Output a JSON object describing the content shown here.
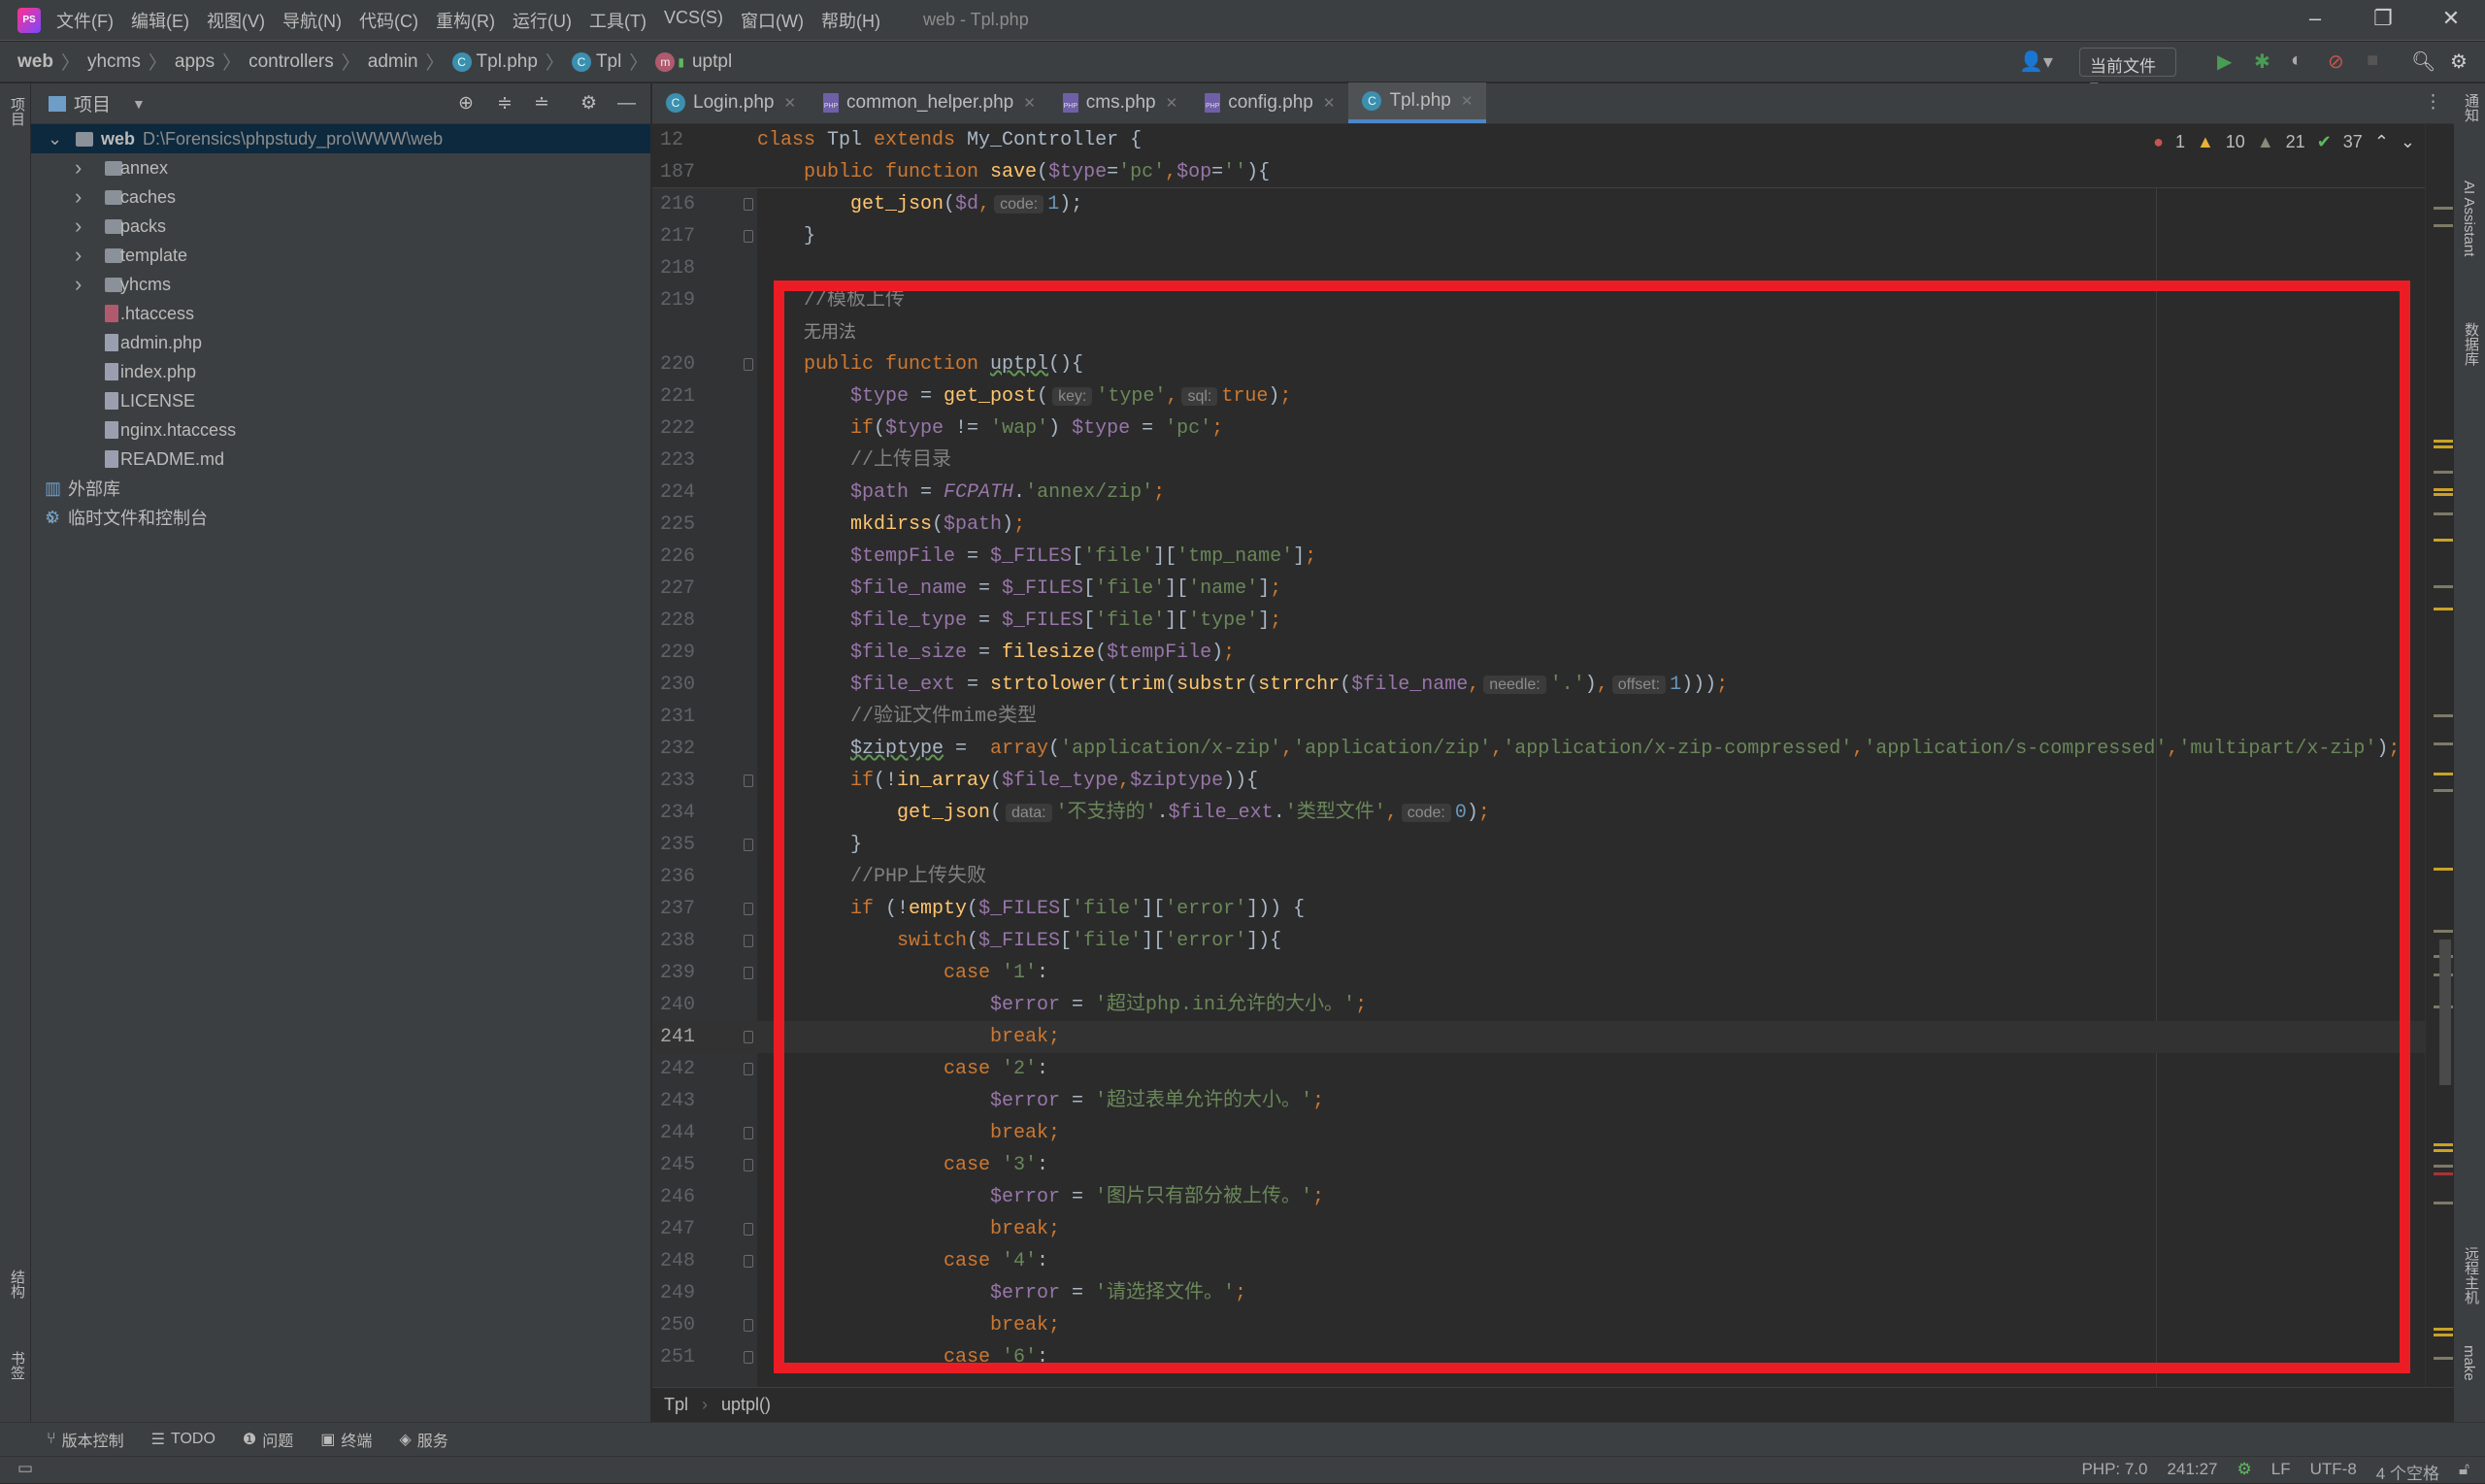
{
  "window": {
    "title": "web - Tpl.php",
    "logo": "PS"
  },
  "menu": [
    "文件(F)",
    "编辑(E)",
    "视图(V)",
    "导航(N)",
    "代码(C)",
    "重构(R)",
    "运行(U)",
    "工具(T)",
    "VCS(S)",
    "窗口(W)",
    "帮助(H)"
  ],
  "breadcrumb": [
    {
      "label": "web",
      "icon": ""
    },
    {
      "label": "yhcms",
      "icon": ""
    },
    {
      "label": "apps",
      "icon": ""
    },
    {
      "label": "controllers",
      "icon": ""
    },
    {
      "label": "admin",
      "icon": ""
    },
    {
      "label": "Tpl.php",
      "icon": "class-icon"
    },
    {
      "label": "Tpl",
      "icon": "class-icon"
    },
    {
      "label": "uptpl",
      "icon": "method-icon"
    }
  ],
  "toolbar": {
    "run_config": "当前文件"
  },
  "left_strip": {
    "project": "项目",
    "structure": "结构",
    "bookmarks": "书签"
  },
  "right_strip": {
    "notifications": "通知",
    "ai": "AI Assistant",
    "database": "数据库",
    "remote": "远程主机",
    "make": "make"
  },
  "project_panel": {
    "title": "项目",
    "tree": [
      {
        "label": "web",
        "path": "D:\\Forensics\\phpstudy_pro\\WWW\\web",
        "type": "folder",
        "level": 0,
        "expanded": true,
        "selected": true
      },
      {
        "label": "annex",
        "type": "folder",
        "level": 1
      },
      {
        "label": "caches",
        "type": "folder",
        "level": 1
      },
      {
        "label": "packs",
        "type": "folder",
        "level": 1
      },
      {
        "label": "template",
        "type": "folder",
        "level": 1
      },
      {
        "label": "yhcms",
        "type": "folder",
        "level": 1
      },
      {
        "label": ".htaccess",
        "type": "file",
        "level": 1
      },
      {
        "label": "admin.php",
        "type": "php",
        "level": 1
      },
      {
        "label": "index.php",
        "type": "php",
        "level": 1
      },
      {
        "label": "LICENSE",
        "type": "file",
        "level": 1
      },
      {
        "label": "nginx.htaccess",
        "type": "file",
        "level": 1
      },
      {
        "label": "README.md",
        "type": "md",
        "level": 1
      },
      {
        "label": "外部库",
        "type": "library",
        "level": 0
      },
      {
        "label": "临时文件和控制台",
        "type": "scratch",
        "level": 0,
        "collapsed": true
      }
    ]
  },
  "tabs": [
    {
      "label": "Login.php",
      "icon": "class-icon",
      "active": false
    },
    {
      "label": "common_helper.php",
      "icon": "php-icon",
      "active": false
    },
    {
      "label": "cms.php",
      "icon": "php-icon",
      "active": false
    },
    {
      "label": "config.php",
      "icon": "php-icon",
      "active": false
    },
    {
      "label": "Tpl.php",
      "icon": "class-icon",
      "active": true
    }
  ],
  "problems": {
    "errors": "1",
    "warnings": "10",
    "weak_warnings": "21",
    "ok": "37"
  },
  "sticky_lines": [
    {
      "n": "12",
      "indent": 0,
      "tokens": [
        [
          "k",
          "class "
        ],
        [
          "d",
          "Tpl "
        ],
        [
          "k",
          "extends "
        ],
        [
          "d",
          "My_Controller {"
        ]
      ]
    },
    {
      "n": "187",
      "indent": 4,
      "tokens": [
        [
          "k",
          "public function "
        ],
        [
          "f",
          "save"
        ],
        [
          "d",
          "("
        ],
        [
          "v",
          "$type"
        ],
        [
          "d",
          "="
        ],
        [
          "s",
          "'pc'"
        ],
        [
          "k",
          ","
        ],
        [
          "v",
          "$op"
        ],
        [
          "d",
          "="
        ],
        [
          "s",
          "''"
        ],
        [
          "d",
          "){"
        ]
      ]
    }
  ],
  "code_lines": [
    {
      "n": "216",
      "indent": 8,
      "fold": true,
      "tokens": [
        [
          "f",
          "get_json"
        ],
        [
          "d",
          "("
        ],
        [
          "v",
          "$d"
        ],
        [
          "k",
          ","
        ],
        [
          "h",
          "code:"
        ],
        [
          "n",
          "1"
        ],
        [
          "d",
          ");"
        ]
      ]
    },
    {
      "n": "217",
      "indent": 4,
      "fold": true,
      "tokens": [
        [
          "d",
          "}"
        ]
      ]
    },
    {
      "n": "218",
      "indent": 0,
      "tokens": []
    },
    {
      "n": "219",
      "indent": 4,
      "tokens": [
        [
          "c",
          "//模板上传"
        ]
      ]
    },
    {
      "n": "",
      "indent": 4,
      "tokens": [
        [
          "p",
          "无用法"
        ]
      ]
    },
    {
      "n": "220",
      "indent": 4,
      "fold": true,
      "tokens": [
        [
          "k",
          "public function "
        ],
        [
          "u",
          "uptpl"
        ],
        [
          "d",
          "(){"
        ]
      ]
    },
    {
      "n": "221",
      "indent": 8,
      "tokens": [
        [
          "v",
          "$type"
        ],
        [
          "d",
          " = "
        ],
        [
          "f",
          "get_post"
        ],
        [
          "d",
          "("
        ],
        [
          "h",
          "key:"
        ],
        [
          "s",
          "'type'"
        ],
        [
          "k",
          ","
        ],
        [
          "h",
          "sql:"
        ],
        [
          "k",
          "true"
        ],
        [
          "d",
          ")"
        ],
        [
          "k",
          ";"
        ]
      ]
    },
    {
      "n": "222",
      "indent": 8,
      "tokens": [
        [
          "k",
          "if"
        ],
        [
          "d",
          "("
        ],
        [
          "v",
          "$type"
        ],
        [
          "d",
          " != "
        ],
        [
          "s",
          "'wap'"
        ],
        [
          "d",
          ") "
        ],
        [
          "v",
          "$type"
        ],
        [
          "d",
          " = "
        ],
        [
          "s",
          "'pc'"
        ],
        [
          "k",
          ";"
        ]
      ]
    },
    {
      "n": "223",
      "indent": 8,
      "tokens": [
        [
          "c",
          "//上传目录"
        ]
      ]
    },
    {
      "n": "224",
      "indent": 8,
      "tokens": [
        [
          "v",
          "$path"
        ],
        [
          "d",
          " = "
        ],
        [
          "i",
          "FCPATH"
        ],
        [
          "d",
          "."
        ],
        [
          "s",
          "'annex/zip'"
        ],
        [
          "k",
          ";"
        ]
      ]
    },
    {
      "n": "225",
      "indent": 8,
      "tokens": [
        [
          "f",
          "mkdirss"
        ],
        [
          "d",
          "("
        ],
        [
          "v",
          "$path"
        ],
        [
          "d",
          ")"
        ],
        [
          "k",
          ";"
        ]
      ]
    },
    {
      "n": "226",
      "indent": 8,
      "tokens": [
        [
          "v",
          "$tempFile"
        ],
        [
          "d",
          " = "
        ],
        [
          "v",
          "$_FILES"
        ],
        [
          "d",
          "["
        ],
        [
          "s",
          "'file'"
        ],
        [
          "d",
          "]["
        ],
        [
          "s",
          "'tmp_name'"
        ],
        [
          "d",
          "]"
        ],
        [
          "k",
          ";"
        ]
      ]
    },
    {
      "n": "227",
      "indent": 8,
      "tokens": [
        [
          "v",
          "$file_name"
        ],
        [
          "d",
          " = "
        ],
        [
          "v",
          "$_FILES"
        ],
        [
          "d",
          "["
        ],
        [
          "s",
          "'file'"
        ],
        [
          "d",
          "]["
        ],
        [
          "s",
          "'name'"
        ],
        [
          "d",
          "]"
        ],
        [
          "k",
          ";"
        ]
      ]
    },
    {
      "n": "228",
      "indent": 8,
      "tokens": [
        [
          "v",
          "$file_type"
        ],
        [
          "d",
          " = "
        ],
        [
          "v",
          "$_FILES"
        ],
        [
          "d",
          "["
        ],
        [
          "s",
          "'file'"
        ],
        [
          "d",
          "]["
        ],
        [
          "s",
          "'type'"
        ],
        [
          "d",
          "]"
        ],
        [
          "k",
          ";"
        ]
      ]
    },
    {
      "n": "229",
      "indent": 8,
      "tokens": [
        [
          "v",
          "$file_size"
        ],
        [
          "d",
          " = "
        ],
        [
          "f",
          "filesize"
        ],
        [
          "d",
          "("
        ],
        [
          "v",
          "$tempFile"
        ],
        [
          "d",
          ")"
        ],
        [
          "k",
          ";"
        ]
      ]
    },
    {
      "n": "230",
      "indent": 8,
      "tokens": [
        [
          "v",
          "$file_ext"
        ],
        [
          "d",
          " = "
        ],
        [
          "f",
          "strtolower"
        ],
        [
          "d",
          "("
        ],
        [
          "f",
          "trim"
        ],
        [
          "d",
          "("
        ],
        [
          "f",
          "substr"
        ],
        [
          "d",
          "("
        ],
        [
          "f",
          "strrchr"
        ],
        [
          "d",
          "("
        ],
        [
          "v",
          "$file_name"
        ],
        [
          "k",
          ","
        ],
        [
          "h",
          "needle:"
        ],
        [
          "s",
          "'.'"
        ],
        [
          "d",
          ")"
        ],
        [
          "k",
          ","
        ],
        [
          "h",
          "offset:"
        ],
        [
          "n",
          "1"
        ],
        [
          "d",
          ")))"
        ],
        [
          "k",
          ";"
        ]
      ]
    },
    {
      "n": "231",
      "indent": 8,
      "tokens": [
        [
          "c",
          "//验证文件mime类型"
        ]
      ]
    },
    {
      "n": "232",
      "indent": 8,
      "tokens": [
        [
          "u",
          "$ziptype"
        ],
        [
          "d",
          " =  "
        ],
        [
          "k",
          "array"
        ],
        [
          "d",
          "("
        ],
        [
          "s",
          "'application/x-zip'"
        ],
        [
          "k",
          ","
        ],
        [
          "s",
          "'application/zip'"
        ],
        [
          "k",
          ","
        ],
        [
          "s",
          "'application/x-zip-compressed'"
        ],
        [
          "k",
          ","
        ],
        [
          "s",
          "'application/s-compressed'"
        ],
        [
          "k",
          ","
        ],
        [
          "s",
          "'multipart/x-zip'"
        ],
        [
          "d",
          ")"
        ],
        [
          "k",
          ";"
        ]
      ]
    },
    {
      "n": "233",
      "indent": 8,
      "fold": true,
      "tokens": [
        [
          "k",
          "if"
        ],
        [
          "d",
          "(!"
        ],
        [
          "f",
          "in_array"
        ],
        [
          "d",
          "("
        ],
        [
          "v",
          "$file_type"
        ],
        [
          "k",
          ","
        ],
        [
          "v",
          "$ziptype"
        ],
        [
          "d",
          "))"
        ],
        [
          "d",
          "{"
        ]
      ]
    },
    {
      "n": "234",
      "indent": 12,
      "tokens": [
        [
          "f",
          "get_json"
        ],
        [
          "d",
          "("
        ],
        [
          "h",
          "data:"
        ],
        [
          "s",
          "'不支持的'"
        ],
        [
          "d",
          "."
        ],
        [
          "v",
          "$file_ext"
        ],
        [
          "d",
          "."
        ],
        [
          "s",
          "'类型文件'"
        ],
        [
          "k",
          ","
        ],
        [
          "h",
          "code:"
        ],
        [
          "n",
          "0"
        ],
        [
          "d",
          ")"
        ],
        [
          "k",
          ";"
        ]
      ]
    },
    {
      "n": "235",
      "indent": 8,
      "fold": true,
      "tokens": [
        [
          "d",
          "}"
        ]
      ]
    },
    {
      "n": "236",
      "indent": 8,
      "tokens": [
        [
          "c",
          "//PHP上传失败"
        ]
      ]
    },
    {
      "n": "237",
      "indent": 8,
      "fold": true,
      "tokens": [
        [
          "k",
          "if "
        ],
        [
          "d",
          "(!"
        ],
        [
          "f",
          "empty"
        ],
        [
          "d",
          "("
        ],
        [
          "v",
          "$_FILES"
        ],
        [
          "d",
          "["
        ],
        [
          "s",
          "'file'"
        ],
        [
          "d",
          "]["
        ],
        [
          "s",
          "'error'"
        ],
        [
          "d",
          "])) {"
        ]
      ]
    },
    {
      "n": "238",
      "indent": 12,
      "fold": true,
      "tokens": [
        [
          "k",
          "switch"
        ],
        [
          "d",
          "("
        ],
        [
          "v",
          "$_FILES"
        ],
        [
          "d",
          "["
        ],
        [
          "s",
          "'file'"
        ],
        [
          "d",
          "]["
        ],
        [
          "s",
          "'error'"
        ],
        [
          "d",
          "]){"
        ]
      ]
    },
    {
      "n": "239",
      "indent": 16,
      "fold": true,
      "tokens": [
        [
          "k",
          "case "
        ],
        [
          "s",
          "'1'"
        ],
        [
          "d",
          ":"
        ]
      ]
    },
    {
      "n": "240",
      "indent": 20,
      "tokens": [
        [
          "v",
          "$error"
        ],
        [
          "d",
          " = "
        ],
        [
          "s",
          "'超过php.ini允许的大小。'"
        ],
        [
          "k",
          ";"
        ]
      ]
    },
    {
      "n": "241",
      "indent": 20,
      "fold": true,
      "current": true,
      "tokens": [
        [
          "k",
          "break;"
        ]
      ]
    },
    {
      "n": "242",
      "indent": 16,
      "fold": true,
      "tokens": [
        [
          "k",
          "case "
        ],
        [
          "s",
          "'2'"
        ],
        [
          "d",
          ":"
        ]
      ]
    },
    {
      "n": "243",
      "indent": 20,
      "tokens": [
        [
          "v",
          "$error"
        ],
        [
          "d",
          " = "
        ],
        [
          "s",
          "'超过表单允许的大小。'"
        ],
        [
          "k",
          ";"
        ]
      ]
    },
    {
      "n": "244",
      "indent": 20,
      "fold": true,
      "tokens": [
        [
          "k",
          "break;"
        ]
      ]
    },
    {
      "n": "245",
      "indent": 16,
      "fold": true,
      "tokens": [
        [
          "k",
          "case "
        ],
        [
          "s",
          "'3'"
        ],
        [
          "d",
          ":"
        ]
      ]
    },
    {
      "n": "246",
      "indent": 20,
      "tokens": [
        [
          "v",
          "$error"
        ],
        [
          "d",
          " = "
        ],
        [
          "s",
          "'图片只有部分被上传。'"
        ],
        [
          "k",
          ";"
        ]
      ]
    },
    {
      "n": "247",
      "indent": 20,
      "fold": true,
      "tokens": [
        [
          "k",
          "break;"
        ]
      ]
    },
    {
      "n": "248",
      "indent": 16,
      "fold": true,
      "tokens": [
        [
          "k",
          "case "
        ],
        [
          "s",
          "'4'"
        ],
        [
          "d",
          ":"
        ]
      ]
    },
    {
      "n": "249",
      "indent": 20,
      "tokens": [
        [
          "v",
          "$error"
        ],
        [
          "d",
          " = "
        ],
        [
          "s",
          "'请选择文件。'"
        ],
        [
          "k",
          ";"
        ]
      ]
    },
    {
      "n": "250",
      "indent": 20,
      "fold": true,
      "tokens": [
        [
          "k",
          "break;"
        ]
      ]
    },
    {
      "n": "251",
      "indent": 16,
      "fold": true,
      "tokens": [
        [
          "k",
          "case "
        ],
        [
          "s",
          "'6'"
        ],
        [
          "d",
          ":"
        ]
      ]
    }
  ],
  "editor_breadcrumb": [
    "Tpl",
    "uptpl()"
  ],
  "tool_windows": [
    {
      "label": "版本控制",
      "icon": "branch-icon"
    },
    {
      "label": "TODO",
      "icon": "list-icon"
    },
    {
      "label": "问题",
      "icon": "problem-icon"
    },
    {
      "label": "终端",
      "icon": "terminal-icon"
    },
    {
      "label": "服务",
      "icon": "services-icon"
    }
  ],
  "status": {
    "php": "PHP: 7.0",
    "position": "241:27",
    "line_sep": "LF",
    "encoding": "UTF-8",
    "indent": "4 个空格"
  },
  "colors": {
    "highlight_box": "#ec1c24",
    "accent": "#4a88c7",
    "keyword": "#cc7832",
    "string": "#6a8759",
    "variable": "#9876aa",
    "function": "#ffc66d"
  }
}
